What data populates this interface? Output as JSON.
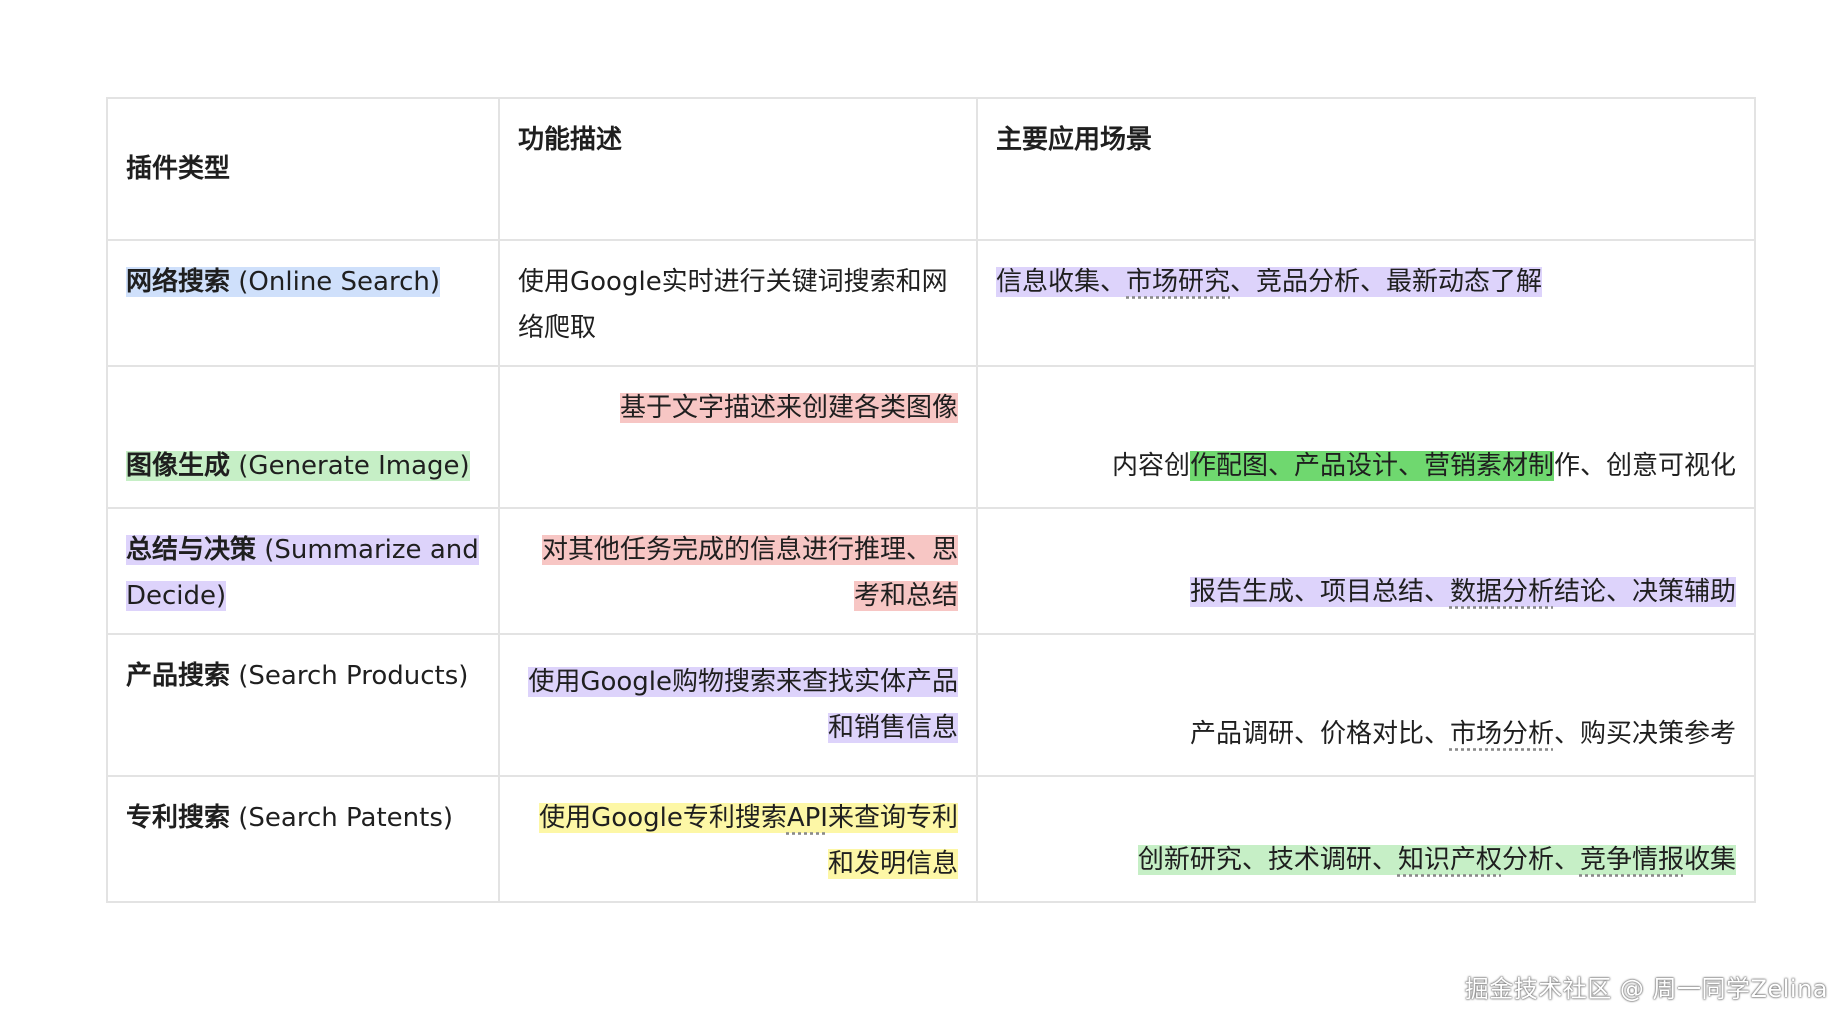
{
  "table": {
    "headers": {
      "col1": "插件类型",
      "col2": "功能描述",
      "col3": "主要应用场景"
    },
    "rows": [
      {
        "type_bold": "网络搜索",
        "type_rest": " (Online Search)",
        "description": "使用Google实时进行关键词搜索和网络爬取",
        "scenario_a": "信息收集、",
        "scenario_b": "市场研究",
        "scenario_c": "、竞品分析、最新动态了解"
      },
      {
        "type_bold": "图像生成",
        "type_rest": " (Generate Image)",
        "description": "基于文字描述来创建各类图像",
        "scenario_a": "内容创",
        "scenario_b": "作配图、产品设计、营销素材制",
        "scenario_c": "作、创意可视化"
      },
      {
        "type_bold": "总结与决策",
        "type_rest": " (Summarize and Decide)",
        "description": "对其他任务完成的信息进行推理、思考和总结",
        "scenario_a": "报告生成、项目总结、",
        "scenario_b": "数据分析",
        "scenario_c": "结论、决策辅助"
      },
      {
        "type_bold": "产品搜索",
        "type_rest": " (Search Products)",
        "description": "使用Google购物搜索来查找实体产品和销售信息",
        "scenario_a": "产品调研、价格对比、",
        "scenario_b": "市场分析",
        "scenario_c": "、购买决策参考"
      },
      {
        "type_bold": "专利搜索",
        "type_rest": " (Search Patents)",
        "description_a": "使用Google专利搜索",
        "description_b": "API",
        "description_c": "来查询专利和发明信息",
        "scenario_a": "创新研究、技术调研、",
        "scenario_b": "知识产权",
        "scenario_c": "分析、",
        "scenario_d": "竞争情报",
        "scenario_e": "收集"
      }
    ]
  },
  "watermark": "掘金技术社区 @ 周一同学Zelina",
  "colors": {
    "blue_highlight": "#cfe0fb",
    "green_highlight": "#c6efc6",
    "green_strong_highlight": "#6fd86f",
    "purple_highlight": "#ddd3fb",
    "red_highlight": "#f7c6c4",
    "yellow_highlight": "#fdf7a6",
    "border": "#e3e3e3"
  }
}
